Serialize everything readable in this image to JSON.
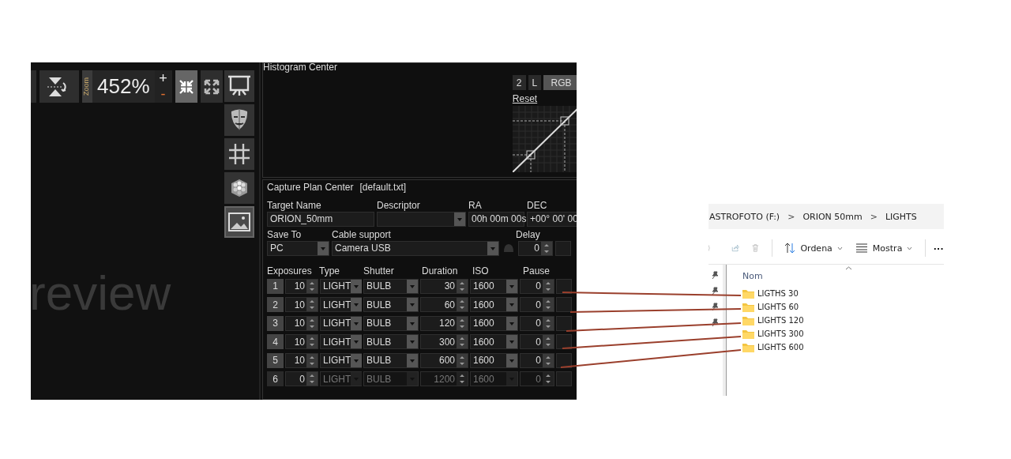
{
  "preview": {
    "zoom_label": "Zoom",
    "zoom_value": "452%",
    "zoom_in": "+",
    "zoom_out": "-",
    "watermark": "review"
  },
  "histogram": {
    "title": "Histogram Center",
    "channels": [
      {
        "label": "2",
        "selected": false
      },
      {
        "label": "L",
        "selected": false
      },
      {
        "label": "RGB",
        "selected": true
      }
    ],
    "reset": "Reset"
  },
  "capture_plan": {
    "title": "Capture Plan Center",
    "file": "[default.txt]",
    "target_name_label": "Target Name",
    "target_name": "ORION_50mm",
    "descriptor_label": "Descriptor",
    "ra_label": "RA",
    "ra": "00h 00m 00s",
    "dec_label": "DEC",
    "dec": "+00° 00' 00",
    "save_to_label": "Save To",
    "save_to": "PC",
    "cable_label": "Cable support",
    "cable": "Camera USB",
    "delay_label": "Delay",
    "delay": "0",
    "columns": [
      "Exposures",
      "Type",
      "Shutter",
      "Duration",
      "ISO",
      "Pause"
    ],
    "rows": [
      {
        "index": "1",
        "exposures": "10",
        "type": "LIGHT",
        "shutter": "BULB",
        "duration": "30",
        "iso": "1600",
        "pause": "0",
        "disabled": false
      },
      {
        "index": "2",
        "exposures": "10",
        "type": "LIGHT",
        "shutter": "BULB",
        "duration": "60",
        "iso": "1600",
        "pause": "0",
        "disabled": false
      },
      {
        "index": "3",
        "exposures": "10",
        "type": "LIGHT",
        "shutter": "BULB",
        "duration": "120",
        "iso": "1600",
        "pause": "0",
        "disabled": false
      },
      {
        "index": "4",
        "exposures": "10",
        "type": "LIGHT",
        "shutter": "BULB",
        "duration": "300",
        "iso": "1600",
        "pause": "0",
        "disabled": false
      },
      {
        "index": "5",
        "exposures": "10",
        "type": "LIGHT",
        "shutter": "BULB",
        "duration": "600",
        "iso": "1600",
        "pause": "0",
        "disabled": false
      },
      {
        "index": "6",
        "exposures": "0",
        "type": "LIGHT",
        "shutter": "BULB",
        "duration": "1200",
        "iso": "1600",
        "pause": "0",
        "disabled": true
      }
    ]
  },
  "explorer": {
    "breadcrumb": [
      "ASTROFOTO (F:)",
      "ORION 50mm",
      "LIGHTS"
    ],
    "separator": ">",
    "toolbar": [
      {
        "label": "Ordena",
        "kind": "sort"
      },
      {
        "label": "Mostra",
        "kind": "view"
      }
    ],
    "more": "···",
    "column": "Nom",
    "folders": [
      "LIGTHS 30",
      "LIGHTS 60",
      "LIGHTS 120",
      "LIGHTS 300",
      "LIGHTS 600"
    ]
  }
}
